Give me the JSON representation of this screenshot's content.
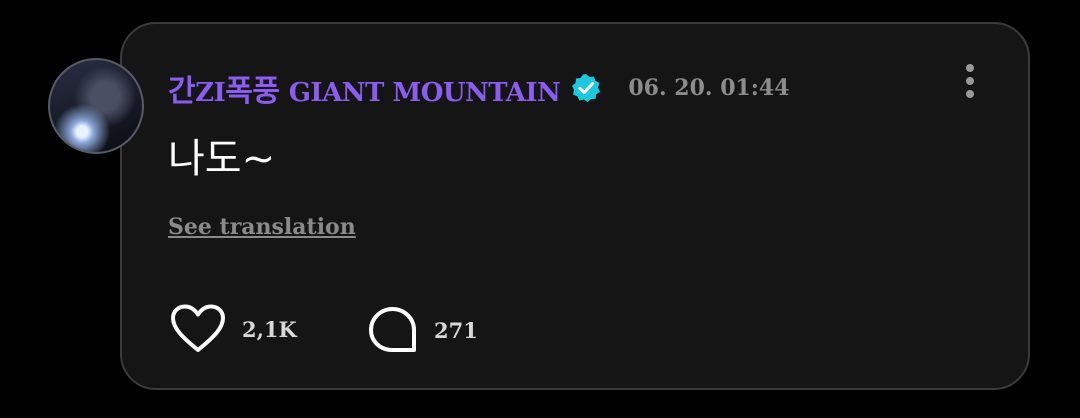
{
  "post": {
    "author": {
      "name_korean": "간",
      "name_zi": "ZI",
      "name_korean2": "폭풍",
      "name_latin": "GIANT MOUNTAIN",
      "verified": true,
      "avatar_icon": "avatar-photo"
    },
    "timestamp": "06. 20. 01:44",
    "text": "나도~",
    "see_translation": "See translation",
    "likes": "2,1K",
    "comments": "271",
    "more_icon": "vertical-dots-icon"
  },
  "colors": {
    "background": "#000000",
    "card": "#151515",
    "card_border": "#3a3a3a",
    "username": "#8a5cf0",
    "verified_badge": "#1cc8e0",
    "timestamp": "#8c8c8c",
    "translate_link": "#8a8a8a",
    "text": "#ffffff"
  }
}
